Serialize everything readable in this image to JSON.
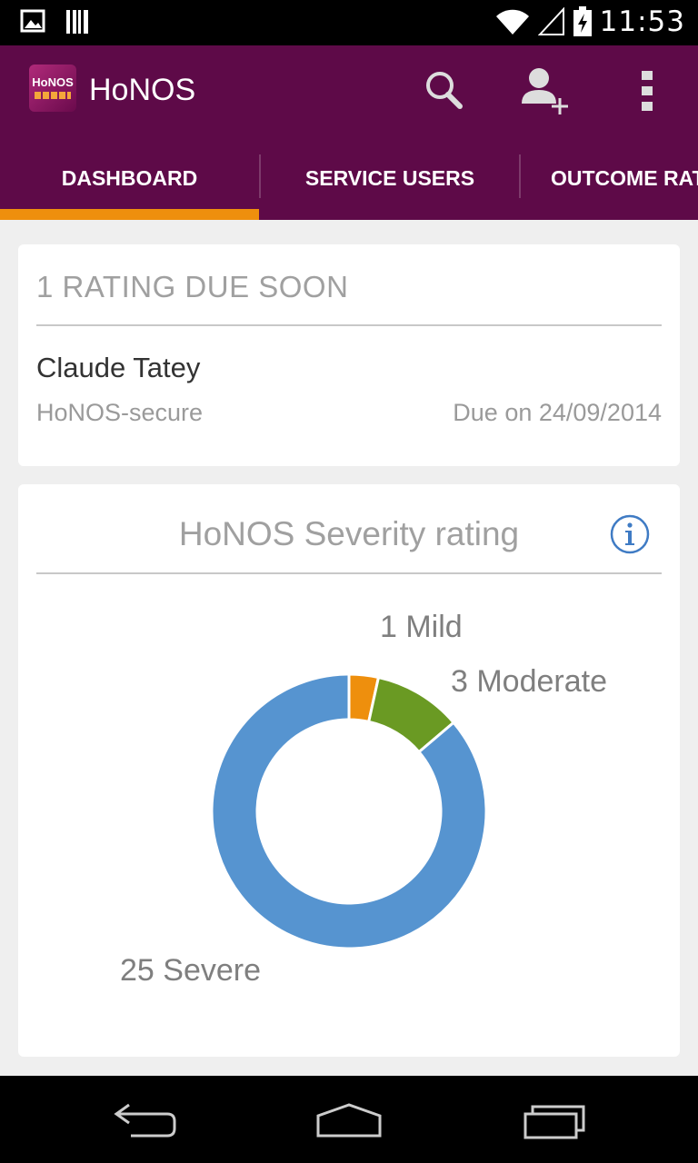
{
  "status_bar": {
    "time": "11:53",
    "icons": [
      "image-notification-icon",
      "barcode-notification-icon",
      "wifi-icon",
      "signal-icon",
      "battery-charging-icon"
    ]
  },
  "app_bar": {
    "logo_text": "HoNOS",
    "title": "HoNOS",
    "actions": [
      "search-icon",
      "add-user-icon",
      "overflow-menu-icon"
    ]
  },
  "tabs": [
    {
      "label": "DASHBOARD",
      "selected": true
    },
    {
      "label": "SERVICE USERS",
      "selected": false
    },
    {
      "label": "OUTCOME RATINGS",
      "selected": false
    }
  ],
  "due_card": {
    "header": "1 RATING DUE SOON",
    "user_name": "Claude Tatey",
    "scale": "HoNOS-secure",
    "due": "Due on 24/09/2014"
  },
  "severity_card": {
    "title": "HoNOS Severity rating"
  },
  "colors": {
    "primary": "#5e0a48",
    "accent": "#ee8f0d",
    "mild": "#ee8f0d",
    "moderate": "#6a9a23",
    "severe": "#5694d0",
    "info": "#3f7bc4"
  },
  "chart_data": {
    "type": "pie",
    "donut": true,
    "title": "",
    "labels": [
      "1 Mild",
      "3 Moderate",
      "25 Severe"
    ],
    "categories": [
      "Mild",
      "Moderate",
      "Severe"
    ],
    "values": [
      1,
      3,
      25
    ],
    "colors": [
      "#ee8f0d",
      "#6a9a23",
      "#5694d0"
    ]
  },
  "nav_bar": {
    "buttons": [
      "back-icon",
      "home-icon",
      "recent-apps-icon"
    ]
  }
}
